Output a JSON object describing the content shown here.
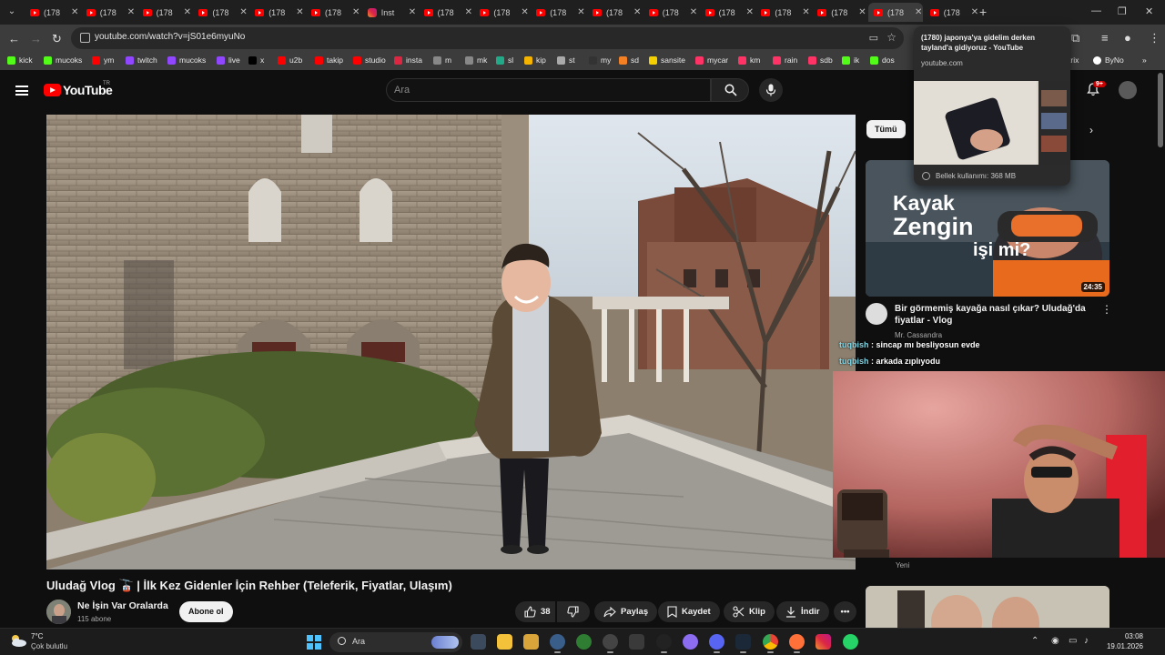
{
  "browser": {
    "tabs": [
      {
        "title": "(178",
        "favicon": "youtube"
      },
      {
        "title": "(178",
        "favicon": "youtube"
      },
      {
        "title": "(178",
        "favicon": "youtube"
      },
      {
        "title": "(178",
        "favicon": "youtube"
      },
      {
        "title": "(178",
        "favicon": "youtube"
      },
      {
        "title": "(178",
        "favicon": "youtube"
      },
      {
        "title": "Inst",
        "favicon": "instagram"
      },
      {
        "title": "(178",
        "favicon": "youtube"
      },
      {
        "title": "(178",
        "favicon": "youtube"
      },
      {
        "title": "(178",
        "favicon": "youtube"
      },
      {
        "title": "(178",
        "favicon": "youtube"
      },
      {
        "title": "(178",
        "favicon": "youtube"
      },
      {
        "title": "(178",
        "favicon": "youtube"
      },
      {
        "title": "(178",
        "favicon": "youtube"
      },
      {
        "title": "(178",
        "favicon": "youtube"
      },
      {
        "title": "(178",
        "favicon": "youtube",
        "active": true
      },
      {
        "title": "(178",
        "favicon": "youtube"
      }
    ],
    "close_glyph": "✕",
    "new_tab_glyph": "+",
    "url": "youtube.com/watch?v=jS01e6myuNo",
    "bookmarks": [
      {
        "label": "kick",
        "color": "#53fc18"
      },
      {
        "label": "mucoks",
        "color": "#53fc18"
      },
      {
        "label": "ym",
        "color": "#ff0000"
      },
      {
        "label": "twitch",
        "color": "#9146ff"
      },
      {
        "label": "mucoks",
        "color": "#9146ff"
      },
      {
        "label": "live",
        "color": "#9146ff"
      },
      {
        "label": "x",
        "color": "#000000"
      },
      {
        "label": "u2b",
        "color": "#ff0000"
      },
      {
        "label": "takip",
        "color": "#ff0000"
      },
      {
        "label": "studio",
        "color": "#ff0000"
      },
      {
        "label": "insta",
        "color": "#dc2743"
      },
      {
        "label": "m",
        "color": "#888888"
      },
      {
        "label": "mk",
        "color": "#888888"
      },
      {
        "label": "sl",
        "color": "#22aa88"
      },
      {
        "label": "kip",
        "color": "#f4b400"
      },
      {
        "label": "st",
        "color": "#aaaaaa"
      },
      {
        "label": "my",
        "color": "#333333"
      },
      {
        "label": "sd",
        "color": "#f48024"
      },
      {
        "label": "sansite",
        "color": "#f4d000"
      },
      {
        "label": "mycar",
        "color": "#ff3366"
      },
      {
        "label": "km",
        "color": "#ff3366"
      },
      {
        "label": "rain",
        "color": "#ff3366"
      },
      {
        "label": "sdb",
        "color": "#ff3366"
      },
      {
        "label": "ik",
        "color": "#53fc18"
      },
      {
        "label": "dos",
        "color": "#53fc18"
      }
    ],
    "bookmarks_overflow": [
      {
        "label": "trix"
      },
      {
        "label": "ByNo"
      }
    ],
    "tab_preview": {
      "title": "(1780) japonya'ya gidelim derken tayland'a gidiyoruz - YouTube",
      "domain": "youtube.com",
      "memory": "Bellek kullanımı: 368 MB"
    }
  },
  "youtube": {
    "logo_text": "YouTube",
    "logo_country": "TR",
    "search_placeholder": "Ara",
    "notification_count": "9+",
    "filter_chip": "Tümü",
    "video": {
      "title": "Uludağ Vlog 🚡 | İlk Kez Gidenler İçin Rehber (Teleferik, Fiyatlar, Ulaşım)",
      "channel": "Ne İşin Var Oralarda",
      "subscribers": "115 abone",
      "subscribe_label": "Abone ol",
      "likes": "38",
      "share_label": "Paylaş",
      "save_label": "Kaydet",
      "clip_label": "Klip",
      "download_label": "İndir"
    },
    "sidebar": {
      "thumb_line1": "Kayak",
      "thumb_line2": "Zengin",
      "thumb_line3": "işi mi?",
      "duration": "24:35",
      "title": "Bir görmemiş kayağa nasıl çıkar? Uludağ'da fiyatlar - Vlog",
      "channel": "Mr. Cassandra",
      "new_badge": "Yeni"
    }
  },
  "stream_overlay": {
    "chat": [
      {
        "user": "tuqbish",
        "message": "sincap mı besliyosun evde"
      },
      {
        "user": "tuqbish",
        "message": "arkada zıplıyodu"
      }
    ]
  },
  "taskbar": {
    "temperature": "7°C",
    "condition": "Çok bulutlu",
    "search_label": "Ara",
    "time": "03:08",
    "date": "19.01.2026"
  }
}
